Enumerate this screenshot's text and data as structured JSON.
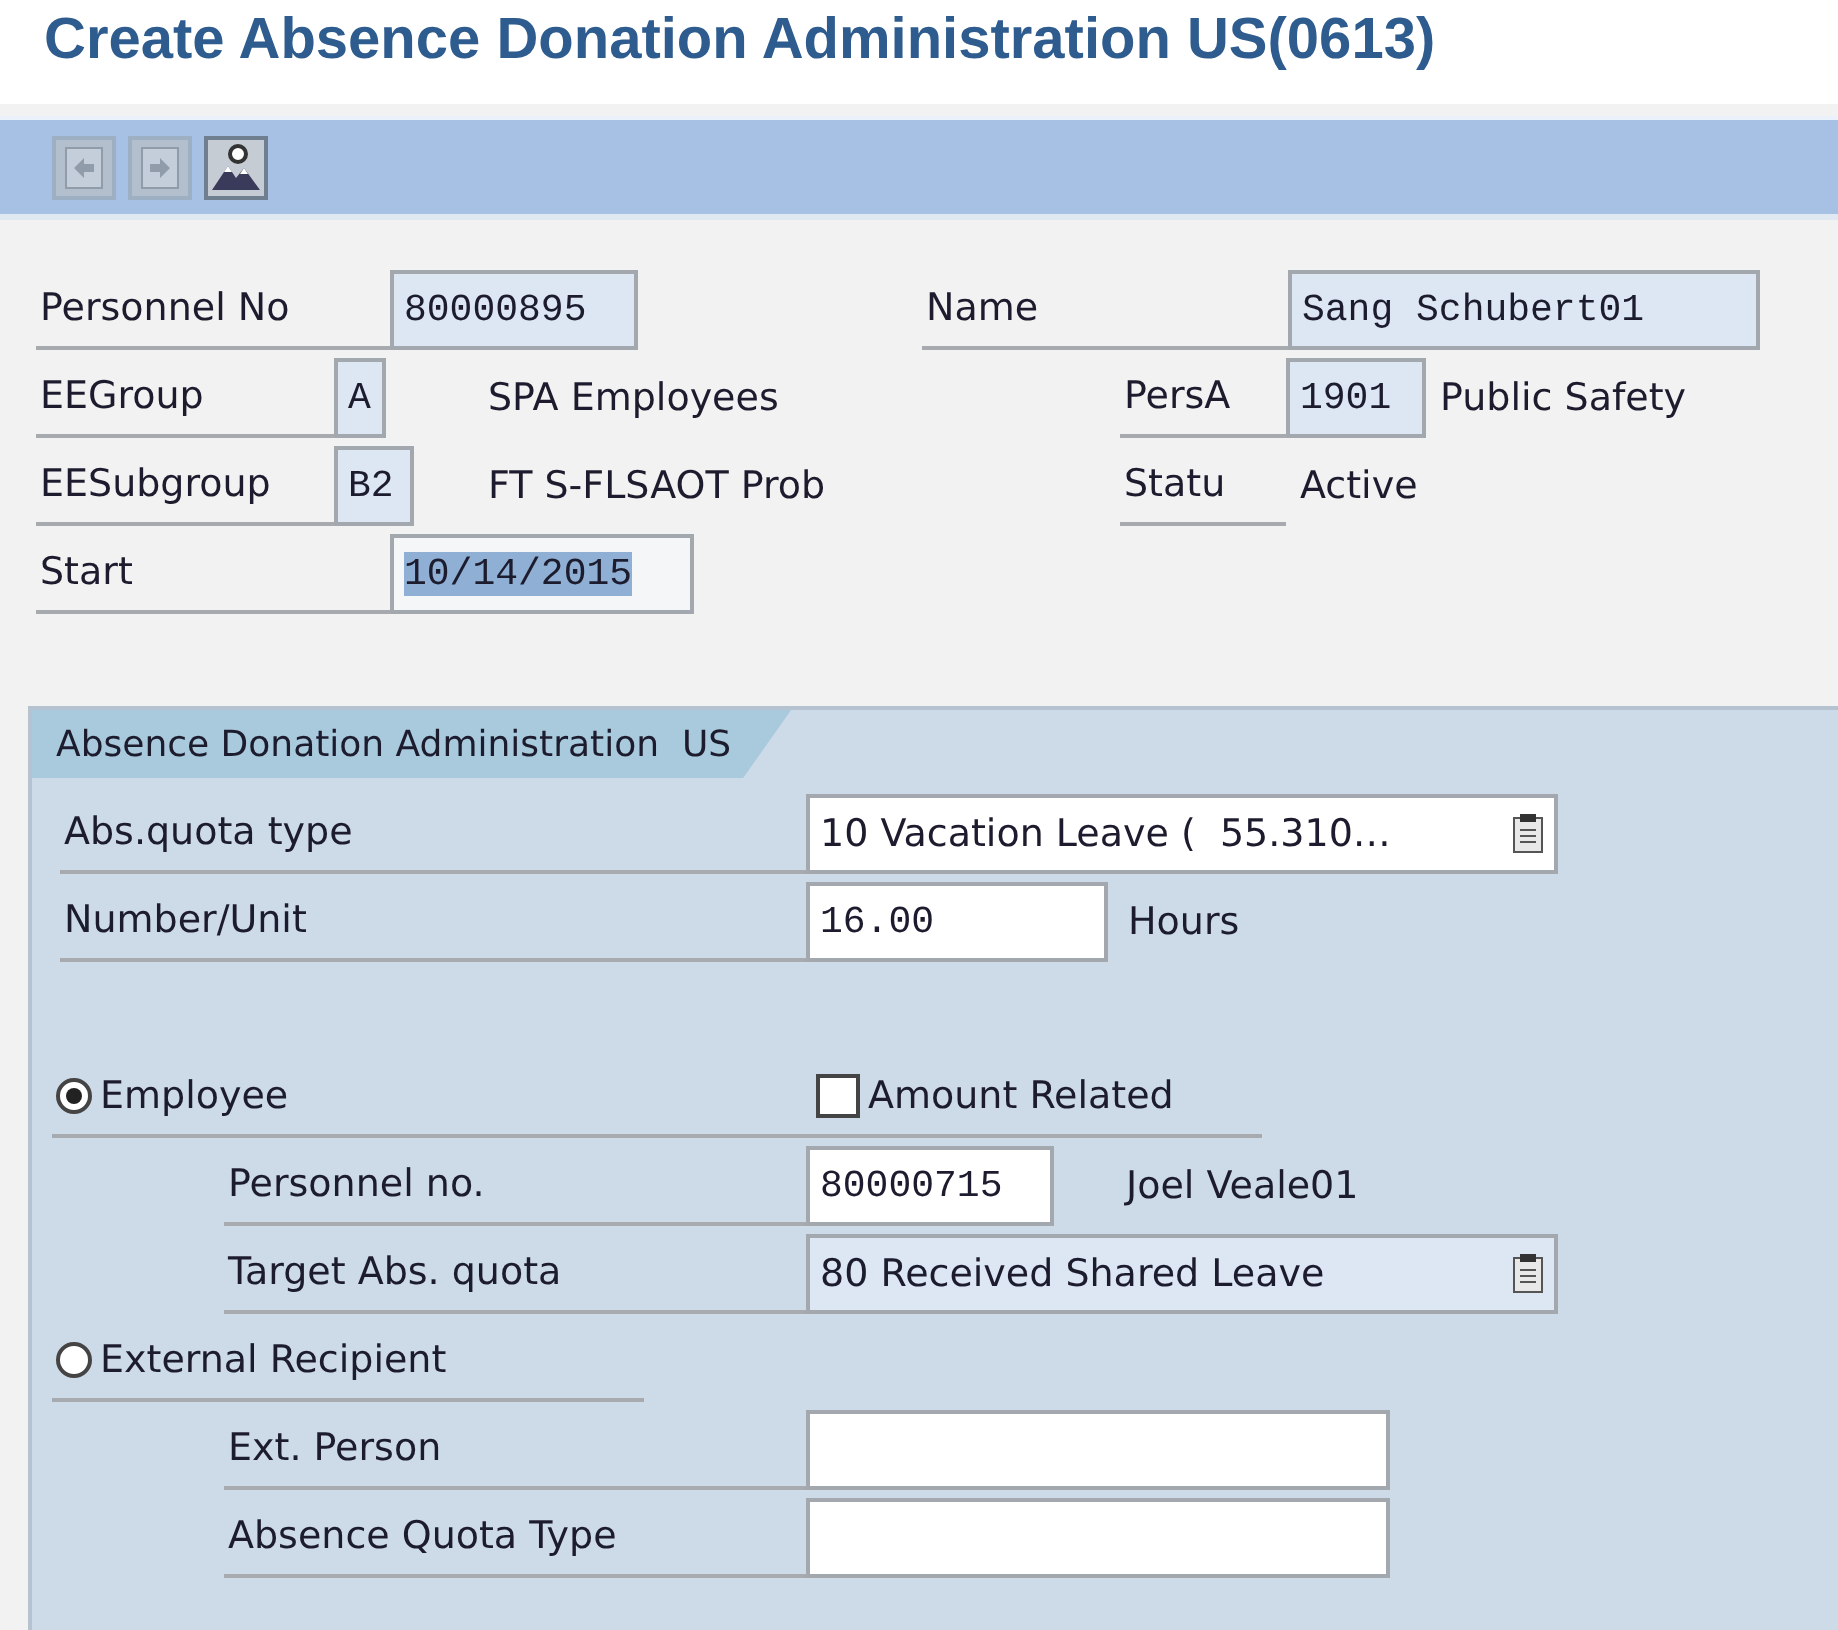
{
  "title": "Create Absence Donation Administration US(0613)",
  "toolbar": [
    {
      "kind": "previous",
      "disabled": true
    },
    {
      "kind": "next",
      "disabled": true
    },
    {
      "kind": "picture",
      "disabled": false
    }
  ],
  "header": {
    "personnel_no": {
      "label": "Personnel No",
      "value": "80000895"
    },
    "name": {
      "label": "Name",
      "value": "Sang Schubert01"
    },
    "ee_group": {
      "label": "EEGroup",
      "value": "A",
      "text": "SPA Employees"
    },
    "pers_area": {
      "label": "PersA",
      "value": "1901",
      "text": "Public Safety"
    },
    "ee_subgroup": {
      "label": "EESubgroup",
      "value": "B2",
      "text": "FT S-FLSAOT Prob"
    },
    "status": {
      "label": "Statu",
      "text": "Active"
    },
    "start": {
      "label": "Start",
      "value": "10/14/2015",
      "selected": true
    }
  },
  "panel": {
    "tab": "Absence Donation Administration  US",
    "abs_quota_type": {
      "label": "Abs.quota type",
      "value": "10 Vacation Leave (  55.310…"
    },
    "number_unit": {
      "label": "Number/Unit",
      "value": "16.00",
      "unit": "Hours"
    },
    "employee_option": {
      "label": "Employee",
      "selected": true
    },
    "amount_related": {
      "label": "Amount Related",
      "checked": false
    },
    "personnel_no": {
      "label": "Personnel no.",
      "value": "80000715",
      "text": "Joel Veale01"
    },
    "target_quota": {
      "label": "Target Abs. quota",
      "value": "80 Received Shared Leave"
    },
    "external_option": {
      "label": "External Recipient",
      "selected": false
    },
    "ext_person": {
      "label": "Ext. Person"
    },
    "absence_quota_type": {
      "label": "Absence Quota Type"
    }
  }
}
